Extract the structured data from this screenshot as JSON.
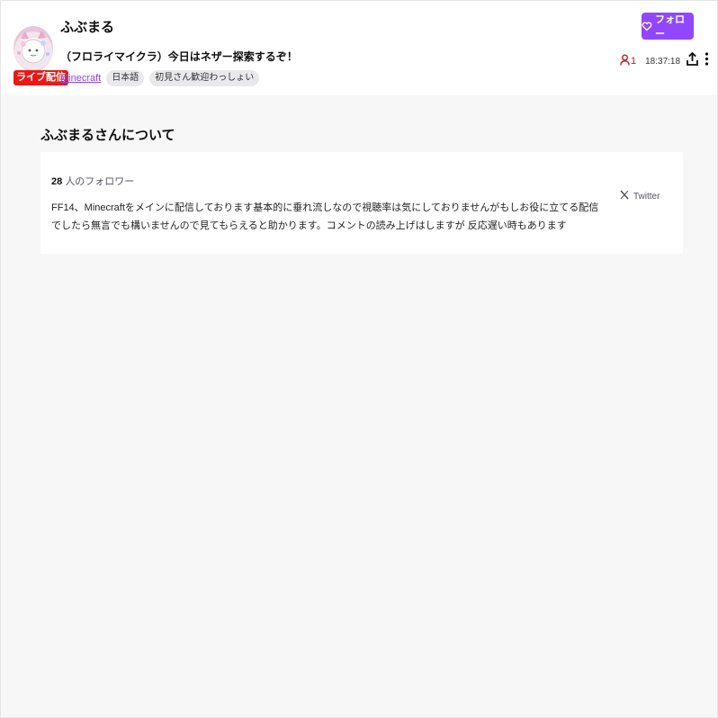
{
  "channel": {
    "name": "ふぶまる",
    "stream_title": "（フロライマイクラ）今日はネザー探索するぞ！",
    "live_label": "ライブ配信",
    "game": "Minecraft",
    "tags": [
      "日本語",
      "初見さん歓迎わっしょい"
    ],
    "follow_label": "フォロー",
    "viewer_count": "1",
    "uptime": "18:37:18"
  },
  "about": {
    "heading": "ふぶまるさんについて",
    "follower_count": "28",
    "follower_suffix": "人のフォロワー",
    "description": "FF14、Minecraftをメインに配信しております基本的に垂れ流しなので視聴率は気にしておりませんがもしお役に立てる配信でしたら無言でも構いませんので見てもらえると助かります。コメントの読み上げはしますが 反応遅い時もあります",
    "social_link": "Twitter"
  },
  "icons": {
    "follow": "heart-icon",
    "viewers": "person-icon",
    "share": "share-icon",
    "more": "more-vertical-icon",
    "social": "x-logo-icon"
  },
  "colors": {
    "accent": "#9147ff",
    "live": "#e91916",
    "viewers": "#c4161c",
    "link": "#8a44f2",
    "background": "#f7f7f8"
  }
}
